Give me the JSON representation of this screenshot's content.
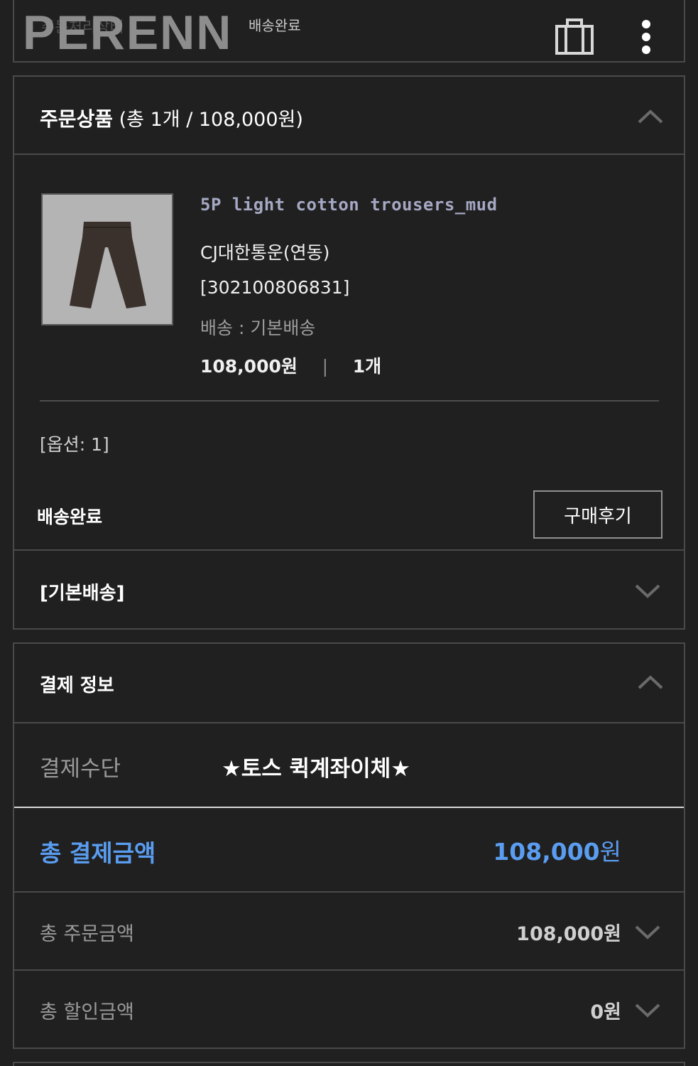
{
  "header": {
    "logo": "PERENN",
    "order_status_label": "주문처리상태",
    "order_status_value": "배송완료",
    "bag_icon": "shopping-bag-icon",
    "menu_icon": "kebab-menu-icon"
  },
  "order_items": {
    "title": "주문상품",
    "summary": "(총 1개 / 108,000원)",
    "product": {
      "name": "5P light cotton trousers_mud",
      "carrier": "CJ대한통운(연동)",
      "tracking": "[302100806831]",
      "shipping": "배송 : 기본배송",
      "price": "108,000원",
      "separator": "|",
      "quantity": "1개",
      "option": "[옵션: 1]",
      "status": "배송완료",
      "review_button": "구매후기"
    },
    "shipping_group": "[기본배송]"
  },
  "payment": {
    "title": "결제 정보",
    "method_label": "결제수단",
    "method_value": "★토스 퀵계좌이체★",
    "total_label": "총 결제금액",
    "total_value": "108,000",
    "total_unit": "원",
    "order_amount_label": "총 주문금액",
    "order_amount_value": "108,000원",
    "discount_label": "총 할인금액",
    "discount_value": "0원"
  },
  "colors": {
    "background": "#202021",
    "accent_blue": "#5a9df0",
    "product_name": "#a5a8c2",
    "border": "#4a4a4b"
  }
}
